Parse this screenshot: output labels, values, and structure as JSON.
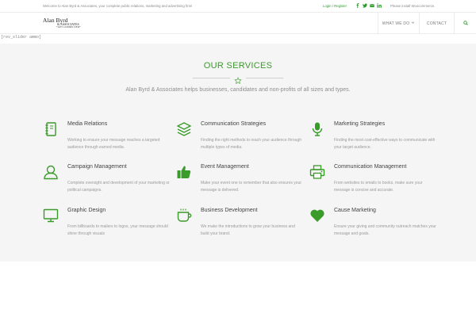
{
  "topbar": {
    "welcome": "Welcome to Alan Byrd & Associates, your complete public relations, marketing and advertising firm!",
    "login": "Login / Register",
    "notice": "Please install Woocommerce."
  },
  "logo": {
    "line1": "Alan Byrd",
    "line2": "& ASSOCIATES",
    "line3": "*GET CONNECTED*"
  },
  "nav": {
    "what_we_do": "WHAT WE DO",
    "contact": "CONTACT"
  },
  "slider_note": "[rev_slider ammo]",
  "section": {
    "title": "OUR SERVICES",
    "subtitle": "Alan Byrd & Associates helps businesses, candidates and non-profits of all sizes and types."
  },
  "colors": {
    "accent": "#3a9a2a",
    "section_bg": "#f5f5f5"
  },
  "services": [
    {
      "icon": "notebook-icon",
      "name": "Media Relations",
      "desc": "Working to ensure your message reaches a targeted audience through earned media."
    },
    {
      "icon": "layers-icon",
      "name": "Communication Strategies",
      "desc": "Finding the right methods to reach your audience through multiple types of media."
    },
    {
      "icon": "microphone-icon",
      "name": "Marketing Strategies",
      "desc": "Finding the most cost-effective ways to communicate with your target audience."
    },
    {
      "icon": "user-icon",
      "name": "Campaign Management",
      "desc": "Complete oversight and development of your marketing or political campaigns."
    },
    {
      "icon": "thumbs-up-icon",
      "name": "Event Management",
      "desc": "Make your event one to remember that also ensures your message is delivered."
    },
    {
      "icon": "printer-icon",
      "name": "Communication Management",
      "desc": "From websites to emails to books, make sure your message is concise and accurate."
    },
    {
      "icon": "monitor-icon",
      "name": "Graphic Design",
      "desc": "From billboards to mailers to logos, your message should shine through visuals"
    },
    {
      "icon": "coffee-icon",
      "name": "Business Development",
      "desc": "We make the introductions to grow your business and build your brand."
    },
    {
      "icon": "heart-icon",
      "name": "Cause Marketing",
      "desc": "Ensure your giving and community outreach matches your message and goals."
    }
  ]
}
